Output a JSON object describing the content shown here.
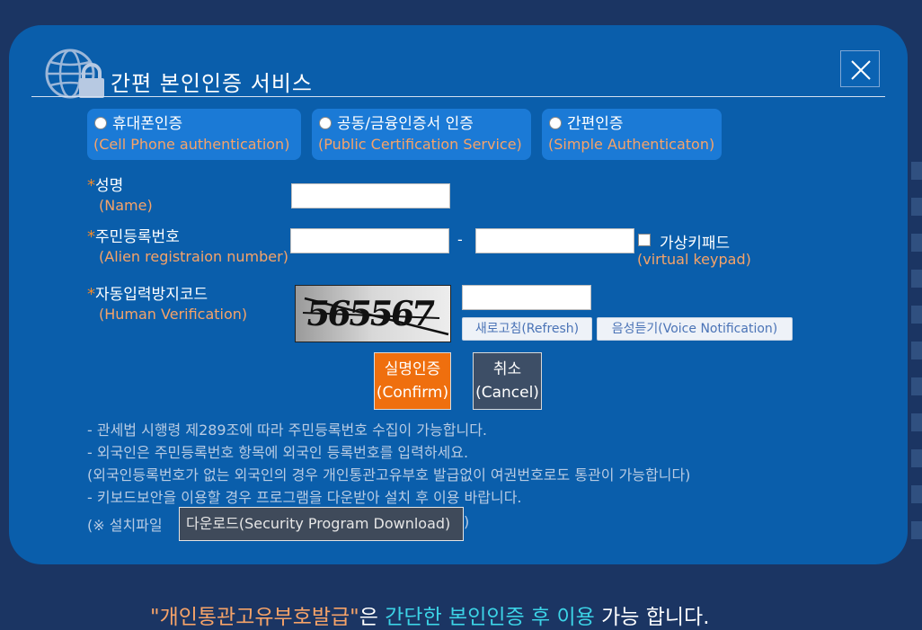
{
  "header": {
    "title": "간편 본인인증 서비스"
  },
  "auth_options": [
    {
      "ko": "휴대폰인증",
      "en": "(Cell Phone authentication)"
    },
    {
      "ko": "공동/금융인증서 인증",
      "en": "(Public Certification Service)"
    },
    {
      "ko": "간편인증",
      "en": "(Simple Authenticaton)"
    }
  ],
  "fields": {
    "name": {
      "star": "*",
      "ko": "성명",
      "en": "(Name)"
    },
    "reg": {
      "star": "*",
      "ko": "주민등록번호",
      "en": "(Alien registraion number)",
      "dash": "-"
    },
    "keypad": {
      "ko": "가상키패드",
      "en": "(virtual keypad)"
    },
    "captcha": {
      "star": "*",
      "ko": "자동입력방지코드",
      "en": "(Human Verification)",
      "image_text": "565567"
    }
  },
  "buttons": {
    "refresh": "새로고침(Refresh)",
    "voice": "음성듣기(Voice Notification)",
    "confirm_ko": "실명인증",
    "confirm_en": "(Confirm)",
    "cancel_ko": "취소",
    "cancel_en": "(Cancel)"
  },
  "notices": [
    "- 관세법 시행령 제289조에 따라 주민등록번호 수집이 가능합니다.",
    "- 외국인은 주민등록번호 항목에 외국인 등록번호를 입력하세요.",
    "(외국인등록번호가 없는 외국인의 경우 개인통관고유부호 발급없이 여권번호로도 통관이 가능합니다)",
    "- 키보드보안을 이용할 경우 프로그램을 다운받아 설치 후 이용 바랍니다."
  ],
  "download": {
    "prefix": "(※ 설치파일",
    "button": "다운로드(Security Program Download)",
    "suffix": ")"
  },
  "footer": {
    "part1": "\"개인통관고유부호발급\"",
    "part2": "은 ",
    "part3": "간단한 본인인증 후 이용",
    "part4": " 가능 합니다."
  },
  "colors": {
    "background": "#1b3563",
    "modal": "#0a5eab",
    "accent_orange": "#f6a368",
    "confirm": "#ef6f0e",
    "cancel": "#3d4e66",
    "footer_cyan": "#3cd3e6"
  }
}
